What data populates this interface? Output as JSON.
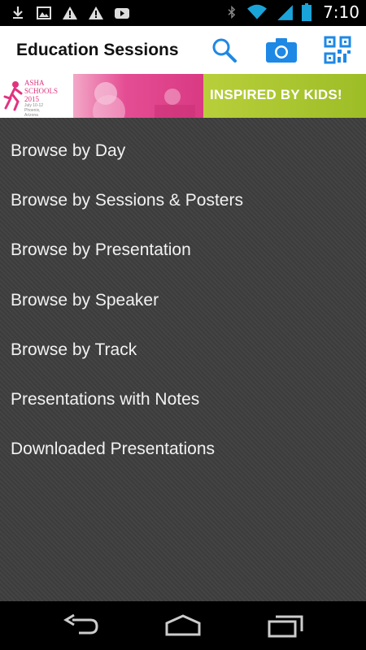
{
  "status_bar": {
    "time": "7:10",
    "left_icons": [
      "download-icon",
      "image-icon",
      "warning-icon",
      "warning-icon",
      "youtube-icon"
    ],
    "right_icons": [
      "bluetooth-icon",
      "wifi-icon",
      "signal-icon",
      "battery-icon"
    ]
  },
  "action_bar": {
    "title": "Education Sessions",
    "icons": [
      "search-icon",
      "camera-icon",
      "qr-code-icon"
    ],
    "accent_color": "#1e88e5"
  },
  "banner": {
    "logo_text": "ASHA SCHOOLS 2015",
    "logo_small_text": "July 10-12 Phoenix, Arizona",
    "tagline": "INSPIRED BY KIDS!",
    "colors": {
      "pink": "#e44d93",
      "green": "#a5c22e"
    }
  },
  "menu": {
    "items": [
      "Browse by Day",
      "Browse by Sessions & Posters",
      "Browse by Presentation",
      "Browse by Speaker",
      "Browse by Track",
      "Presentations with Notes",
      "Downloaded Presentations"
    ]
  },
  "nav_bar": {
    "buttons": [
      "back-icon",
      "home-icon",
      "recent-apps-icon"
    ]
  }
}
